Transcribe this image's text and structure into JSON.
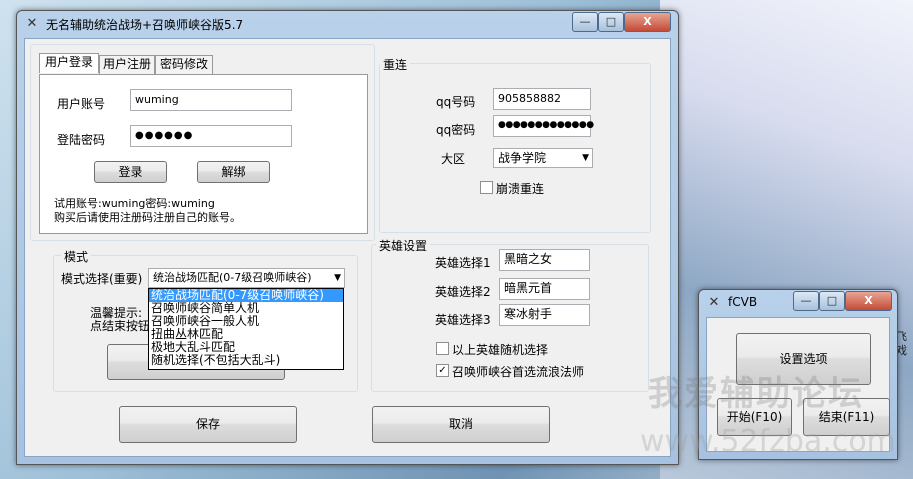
{
  "main_window": {
    "title": "无名辅助统治战场+召唤师峡谷版5.7",
    "controls": {
      "minimize": "—",
      "maximize": "□",
      "close": "X"
    },
    "tabs": [
      {
        "label": "用户登录"
      },
      {
        "label": "用户注册"
      },
      {
        "label": "密码修改"
      }
    ],
    "login": {
      "account_label": "用户账号",
      "account_value": "wuming",
      "password_label": "登陆密码",
      "password_value": "●●●●●●",
      "login_button": "登录",
      "unbind_button": "解绑",
      "trial_line1": "试用账号:wuming密码:wuming",
      "trial_line2": "购买后请使用注册码注册自己的账号。"
    },
    "reconnect": {
      "group_title": "重连",
      "qq_label": "qq号码",
      "qq_value": "905858882",
      "qqpass_label": "qq密码",
      "qqpass_value": "●●●●●●●●●●●●●",
      "region_label": "大区",
      "region_value": "战争学院",
      "crash_checkbox_label": "崩溃重连",
      "crash_checked": false
    },
    "mode": {
      "group_title": "模式",
      "select_label": "模式选择(重要)",
      "selected": "统治战场匹配(0-7级召唤师峡谷)",
      "tip_line1": "温馨提示:",
      "tip_line2": "点结束按钮",
      "options": [
        "统治战场匹配(0-7级召唤师峡谷)",
        "召唤师峡谷简单人机",
        "召唤师峡谷一般人机",
        "扭曲丛林匹配",
        "极地大乱斗匹配",
        "随机选择(不包括大乱斗)"
      ]
    },
    "heroes": {
      "group_title": "英雄设置",
      "picks": [
        {
          "label": "英雄选择1",
          "value": "黑暗之女"
        },
        {
          "label": "英雄选择2",
          "value": "暗黑元首"
        },
        {
          "label": "英雄选择3",
          "value": "寒冰射手"
        }
      ],
      "random_checkbox_label": "以上英雄随机选择",
      "random_checked": false,
      "flow_checkbox_label": "召唤师峡谷首选流浪法师",
      "flow_checked": true
    },
    "save_button": "保存",
    "cancel_button": "取消"
  },
  "small_window": {
    "title": "fCVB",
    "settings_button": "设置选项",
    "start_button": "开始(F10)",
    "stop_button": "结束(F11)"
  },
  "desktop": {
    "icon_label_line1": "飞",
    "icon_label_line2": "戏",
    "watermark": "我爱辅助论坛",
    "watermark_url": "www.52fzba.com"
  },
  "checkmark": "✓"
}
